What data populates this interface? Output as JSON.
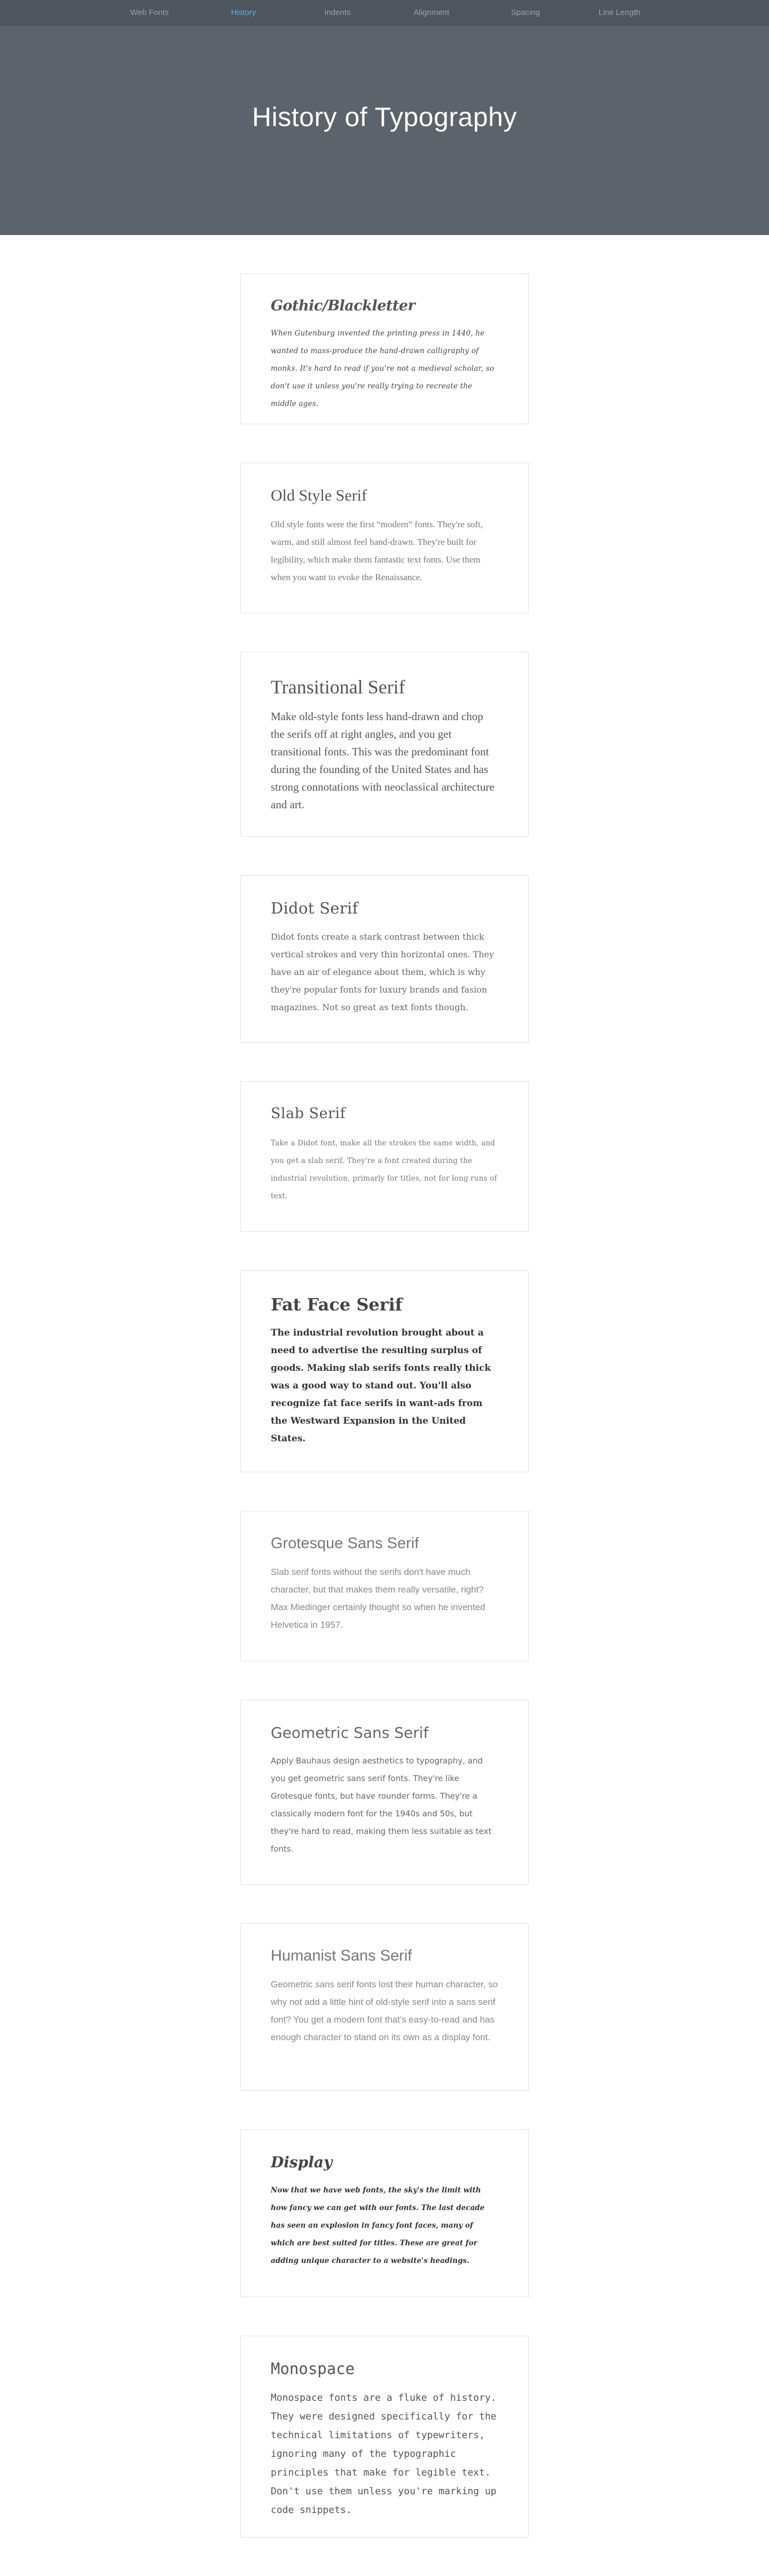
{
  "nav": {
    "items": [
      {
        "label": "Web Fonts",
        "active": false
      },
      {
        "label": "History",
        "active": true
      },
      {
        "label": "Indents",
        "active": false
      },
      {
        "label": "Alignment",
        "active": false
      },
      {
        "label": "Spacing",
        "active": false
      },
      {
        "label": "Line Length",
        "active": false
      }
    ],
    "background": "#4e555c",
    "active_color": "#5ab4dd"
  },
  "hero": {
    "title": "History of Typography",
    "background": "#5c636a"
  },
  "cards": [
    {
      "title": "Gothic/Blackletter",
      "body": "When Gutenburg invented the printing press in 1440, he wanted to mass-produce the hand-drawn calligraphy of monks. It's hard to read if you're not a medieval scholar, so don't use it unless you're really trying to recreate the middle ages."
    },
    {
      "title": "Old Style Serif",
      "body": "Old style fonts were the first “modern” fonts. They're soft, warm, and still almost feel hand-drawn. They're built for legibility, which make them fantastic text fonts. Use them when you want to evoke the Renaissance."
    },
    {
      "title": "Transitional Serif",
      "body": "Make old-style fonts less hand-drawn and chop the serifs off at right angles, and you get transitional fonts. This was the predominant font during the founding of the United States and has strong connotations with neoclassical architecture and art."
    },
    {
      "title": "Didot Serif",
      "body": "Didot fonts create a stark contrast between thick vertical strokes and very thin horizontal ones. They have an air of elegance about them, which is why they're popular fonts for luxury brands and fasion magazines. Not so great as text fonts though."
    },
    {
      "title": "Slab Serif",
      "body": "Take a Didot font, make all the strokes the same width, and you get a slab serif. They're a font created during the industrial revolution, primarly for titles, not for long runs of text."
    },
    {
      "title": "Fat Face Serif",
      "body": "The industrial revolution brought about a need to advertise the resulting surplus of goods. Making slab serifs fonts really thick was a good way to stand out. You'll also recognize fat face serifs in want-ads from the Westward Expansion in the United States."
    },
    {
      "title": "Grotesque Sans Serif",
      "body": "Slab serif fonts without the serifs don't have much character, but that makes them really versatile, right? Max Miedinger certainly thought so when he invented Helvetica in 1957."
    },
    {
      "title": "Geometric Sans Serif",
      "body": "Apply Bauhaus design aesthetics to typography, and you get geometric sans serif fonts. They're like Grotesque fonts, but have rounder forms. They're a classically modern font for the 1940s and 50s, but they're hard to read, making them less suitable as text fonts."
    },
    {
      "title": "Humanist Sans Serif",
      "body": "Geometric sans serif fonts lost their human character, so why not add a little hint of old-style serif into a sans serif font? You get a modern font that's easy-to-read and has enough character to stand on its own as a display font."
    },
    {
      "title": "Display",
      "body": "Now that we have web fonts, the sky's the limit with how fancy we can get with our fonts. The last decade has seen an explosion in fancy font faces, many of which are best suited for titles. These are great for adding unique character to a website's headings."
    },
    {
      "title": "Monospace",
      "body": "Monospace fonts are a fluke of history. They were designed specifically for the technical limitations of typewriters, ignoring many of the typographic principles that make for legible text. Don't use them unless you're marking up code snippets."
    }
  ]
}
